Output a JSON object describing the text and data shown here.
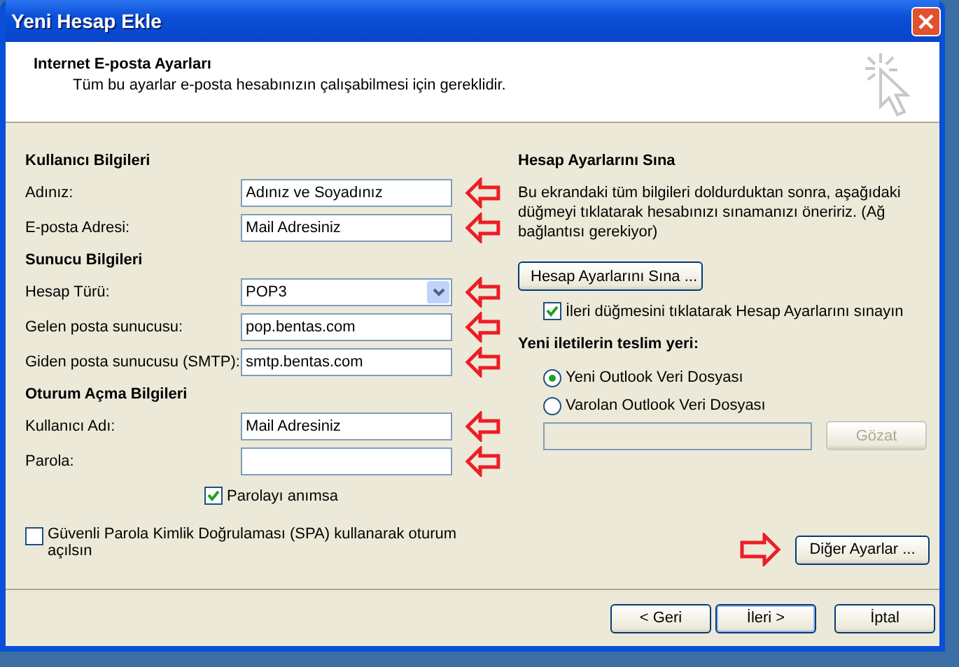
{
  "window": {
    "title": "Yeni Hesap Ekle"
  },
  "header": {
    "title": "Internet E-posta Ayarları",
    "subtitle": "Tüm bu ayarlar e-posta hesabınızın çalışabilmesi için gereklidir."
  },
  "left_sections": [
    {
      "heading": "Kullanıcı Bilgileri",
      "fields": [
        {
          "label": "Adınız:",
          "kind": "text",
          "value": "Adınız ve Soyadınız",
          "arrow": true
        },
        {
          "label": "E-posta Adresi:",
          "kind": "text",
          "value": "Mail Adresiniz",
          "arrow": true
        }
      ]
    },
    {
      "heading": "Sunucu Bilgileri",
      "fields": [
        {
          "label": "Hesap Türü:",
          "kind": "select",
          "value": "POP3",
          "arrow": true
        },
        {
          "label": "Gelen posta sunucusu:",
          "kind": "text",
          "value": "pop.bentas.com",
          "arrow": true
        },
        {
          "label": "Giden posta sunucusu (SMTP):",
          "kind": "text",
          "value": "smtp.bentas.com",
          "arrow": true
        }
      ]
    },
    {
      "heading": "Oturum Açma Bilgileri",
      "fields": [
        {
          "label": "Kullanıcı Adı:",
          "kind": "text",
          "value": "Mail Adresiniz",
          "arrow": true
        },
        {
          "label": "Parola:",
          "kind": "password",
          "arrow": true
        }
      ]
    }
  ],
  "remember_password": {
    "label": "Parolayı anımsa",
    "checked": true
  },
  "spa": {
    "label": "Güvenli Parola Kimlik Doğrulaması (SPA) kullanarak oturum açılsın",
    "checked": false
  },
  "test": {
    "heading": "Hesap Ayarlarını Sına",
    "description": "Bu ekrandaki tüm bilgileri doldurduktan sonra, aşağıdaki düğmeyi tıklatarak hesabınızı sınamanızı öneririz. (Ağ bağlantısı gerekiyor)",
    "button": "Hesap Ayarlarını Sına ...",
    "auto_test": {
      "label": "İleri düğmesini tıklatarak Hesap Ayarlarını sınayın",
      "checked": true
    }
  },
  "delivery": {
    "heading": "Yeni iletilerin teslim yeri:",
    "options": [
      {
        "label": "Yeni Outlook Veri Dosyası",
        "selected": true
      },
      {
        "label": "Varolan Outlook Veri Dosyası",
        "selected": false
      }
    ],
    "browse_button": {
      "label": "Gözat",
      "disabled": true
    }
  },
  "more_settings": {
    "label": "Diğer Ayarlar ...",
    "arrow": true
  },
  "buttons": [
    {
      "label": "< Geri",
      "default": false
    },
    {
      "label": "İleri >",
      "default": true
    },
    {
      "label": "İptal",
      "default": false
    }
  ]
}
